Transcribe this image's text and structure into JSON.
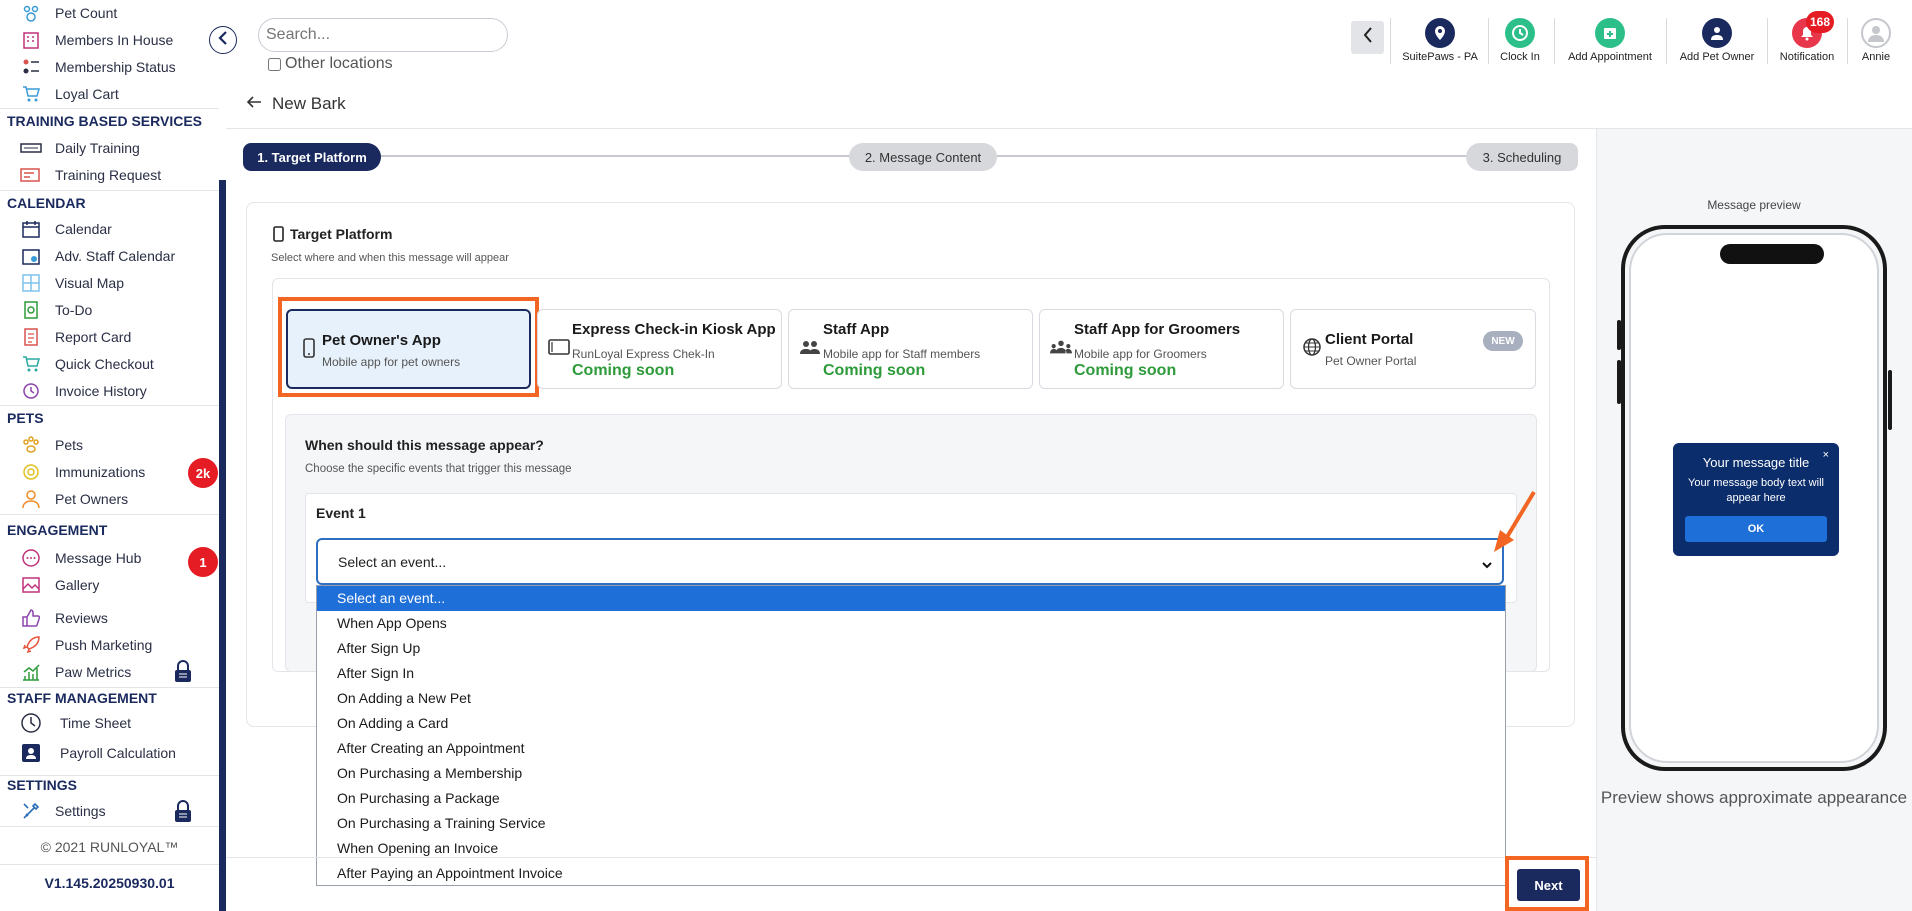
{
  "sidebar": {
    "items_top": [
      {
        "label": "Pet Count",
        "icon": "paw-count-icon"
      },
      {
        "label": "Members In House",
        "icon": "building-icon"
      },
      {
        "label": "Membership Status",
        "icon": "membership-icon"
      },
      {
        "label": "Loyal Cart",
        "icon": "cart-icon"
      }
    ],
    "sections": [
      {
        "title": "TRAINING BASED SERVICES",
        "items": [
          {
            "label": "Daily Training",
            "icon": "training-icon"
          },
          {
            "label": "Training Request",
            "icon": "training-request-icon"
          }
        ]
      },
      {
        "title": "CALENDAR",
        "items": [
          {
            "label": "Calendar",
            "icon": "calendar-icon"
          },
          {
            "label": "Adv. Staff Calendar",
            "icon": "staff-calendar-icon"
          },
          {
            "label": "Visual Map",
            "icon": "map-grid-icon"
          },
          {
            "label": "To-Do",
            "icon": "todo-icon"
          },
          {
            "label": "Report Card",
            "icon": "report-card-icon"
          },
          {
            "label": "Quick Checkout",
            "icon": "checkout-icon"
          },
          {
            "label": "Invoice History",
            "icon": "invoice-history-icon"
          }
        ]
      },
      {
        "title": "PETS",
        "items": [
          {
            "label": "Pets",
            "icon": "paw-icon"
          },
          {
            "label": "Immunizations",
            "icon": "shield-icon"
          },
          {
            "label": "Pet Owners",
            "icon": "person-icon"
          }
        ]
      },
      {
        "title": "ENGAGEMENT",
        "items": [
          {
            "label": "Message Hub",
            "icon": "chat-icon"
          },
          {
            "label": "Gallery",
            "icon": "gallery-icon"
          },
          {
            "label": "Reviews",
            "icon": "thumbs-up-icon"
          },
          {
            "label": "Push Marketing",
            "icon": "rocket-icon"
          },
          {
            "label": "Paw Metrics",
            "icon": "chart-icon"
          }
        ]
      },
      {
        "title": "STAFF MANAGEMENT",
        "items": [
          {
            "label": "Time Sheet",
            "icon": "clock-icon"
          },
          {
            "label": "Payroll Calculation",
            "icon": "payroll-icon"
          }
        ]
      },
      {
        "title": "SETTINGS",
        "items": [
          {
            "label": "Settings",
            "icon": "tools-icon"
          }
        ]
      }
    ],
    "badges": {
      "immunizations": "2k",
      "message_hub": "1"
    },
    "copyright": "© 2021  RUNLOYAL™",
    "version": "V1.145.20250930.01"
  },
  "topbar": {
    "search_placeholder": "Search...",
    "other_locations": "Other locations",
    "tools": [
      {
        "label": "SuitePaws - PA",
        "icon": "location-pin-icon",
        "color": "#1b2a5e"
      },
      {
        "label": "Clock In",
        "icon": "clock-icon",
        "color": "#2dbf8a"
      },
      {
        "label": "Add Appointment",
        "icon": "calendar-add-icon",
        "color": "#2dbf8a"
      },
      {
        "label": "Add Pet Owner",
        "icon": "add-user-icon",
        "color": "#1b2a5e"
      },
      {
        "label": "Notification",
        "icon": "bell-icon",
        "color": "#e8364b"
      },
      {
        "label": "Annie",
        "icon": "avatar-icon",
        "color": "#c5c7cc"
      }
    ],
    "notification_count": "168"
  },
  "page": {
    "title": "New Bark",
    "steps": [
      "1. Target Platform",
      "2. Message Content",
      "3. Scheduling"
    ],
    "active_step": 0
  },
  "target_platform": {
    "title": "Target Platform",
    "subtitle": "Select where and when this message will appear",
    "cards": [
      {
        "title": "Pet Owner's App",
        "subtitle": "Mobile app for pet owners",
        "status": ""
      },
      {
        "title": "Express Check-in Kiosk App",
        "subtitle": "RunLoyal Express Chek-In",
        "status": "Coming soon"
      },
      {
        "title": "Staff App",
        "subtitle": "Mobile app for Staff members",
        "status": "Coming soon"
      },
      {
        "title": "Staff App for Groomers",
        "subtitle": "Mobile app for Groomers",
        "status": "Coming soon"
      },
      {
        "title": "Client Portal",
        "subtitle": "Pet Owner Portal",
        "status": "",
        "badge": "NEW"
      }
    ]
  },
  "event": {
    "question": "When should this message appear?",
    "question_sub": "Choose the specific events that trigger this message",
    "label": "Event 1",
    "selected": "Select an event...",
    "options": [
      "Select an event...",
      "When App Opens",
      "After Sign Up",
      "After Sign In",
      "On Adding a New Pet",
      "On Adding a Card",
      "After Creating an Appointment",
      "On Purchasing a Membership",
      "On Purchasing a Package",
      "On Purchasing a Training Service",
      "When Opening an Invoice",
      "After Paying an Appointment Invoice"
    ]
  },
  "footer": {
    "next_label": "Next"
  },
  "preview": {
    "label": "Message preview",
    "popup_title": "Your message title",
    "popup_close": "×",
    "popup_body": "Your message body text will appear here",
    "popup_ok": "OK",
    "note": "Preview shows approximate appearance"
  },
  "colors": {
    "navy": "#1b2a5e",
    "accent_orange": "#f26522",
    "coming_soon_green": "#2e9b3a",
    "select_blue": "#1f6fd9"
  }
}
